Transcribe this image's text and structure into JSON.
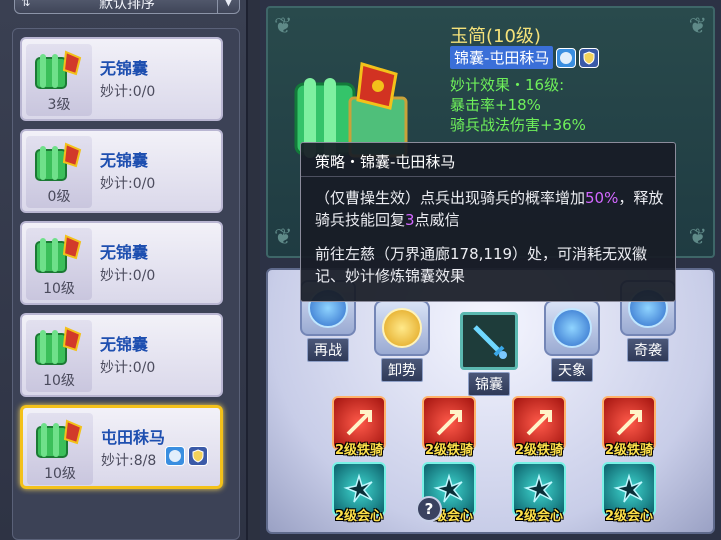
{
  "sort": {
    "label": "默认排序"
  },
  "list": [
    {
      "name": "无锦囊",
      "count": "妙计:0/0",
      "level": "3级",
      "selected": false
    },
    {
      "name": "无锦囊",
      "count": "妙计:0/0",
      "level": "0级",
      "selected": false
    },
    {
      "name": "无锦囊",
      "count": "妙计:0/0",
      "level": "10级",
      "selected": false
    },
    {
      "name": "无锦囊",
      "count": "妙计:0/0",
      "level": "10级",
      "selected": false
    },
    {
      "name": "屯田秣马",
      "count": "妙计:8/8",
      "level": "10级",
      "selected": true
    }
  ],
  "detail": {
    "title": "玉简(10级)",
    "sub_name": "锦囊-屯田秣马",
    "effect_head": "妙计效果・16级:",
    "effect_1": "暴击率+18%",
    "effect_2": "骑兵战法伤害+36%"
  },
  "tooltip": {
    "title": "策略・锦囊-屯田秣马",
    "body_a": "（仅曹操生效）点兵出现骑兵的概率增加",
    "body_pct": "50%",
    "body_b": "，释放骑兵技能回复",
    "body_num": "3",
    "body_c": "点威信",
    "path": "前往左慈（万界通廊178,119）处，可消耗无双徽记、妙计修炼锦囊效果"
  },
  "tree": {
    "nodes": {
      "zaizhan": "再战",
      "xieshi": "卸势",
      "jinnang": "锦囊",
      "tianxiang": "天象",
      "qixi": "奇袭"
    },
    "red_chips": [
      "2级铁骑",
      "2级铁骑",
      "2级铁骑",
      "2级铁骑"
    ],
    "teal_chips": [
      "2级会心",
      "2级会心",
      "2级会心",
      "2级会心"
    ],
    "help": "?"
  },
  "colors": {
    "title_gold": "#f5e27a",
    "effect_green": "#6ef05a",
    "highlight_purple": "#d268ff",
    "selected_border": "#f3c11a",
    "item_name_blue": "#1e4fb0"
  },
  "icons": {
    "sort": "sort-icon",
    "dropdown": "chevron-down-icon",
    "fan": "fan-icon",
    "shield": "shield-icon",
    "scroll": "scroll-icon"
  }
}
